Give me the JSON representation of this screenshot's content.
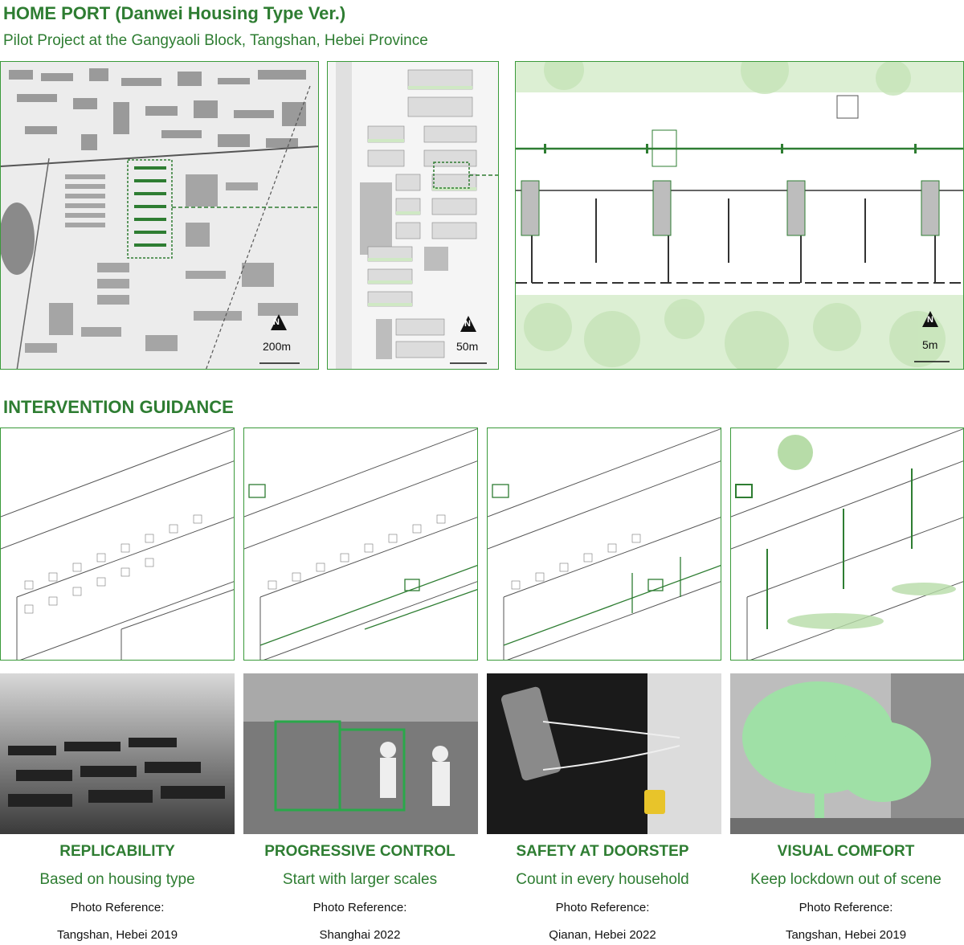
{
  "header": {
    "title": "HOME PORT (Danwei Housing Type Ver.)",
    "subtitle": "Pilot Project at the Gangyaoli Block, Tangshan, Hebei Province"
  },
  "maps": [
    {
      "north": "N",
      "scale": "200m"
    },
    {
      "north": "N",
      "scale": "50m"
    },
    {
      "north": "N",
      "scale": "5m"
    }
  ],
  "section_title": "INTERVENTION GUIDANCE",
  "guidance": [
    {
      "heading": "REPLICABILITY",
      "sub": "Based on housing type",
      "ref_label": "Photo Reference:",
      "ref_place": "Tangshan, Hebei 2019"
    },
    {
      "heading": "PROGRESSIVE CONTROL",
      "sub": "Start with larger scales",
      "ref_label": "Photo Reference:",
      "ref_place": "Shanghai 2022"
    },
    {
      "heading": "SAFETY AT DOORSTEP",
      "sub": "Count in every household",
      "ref_label": "Photo Reference:",
      "ref_place": "Qianan, Hebei 2022"
    },
    {
      "heading": "VISUAL COMFORT",
      "sub": "Keep lockdown out of scene",
      "ref_label": "Photo Reference:",
      "ref_place": "Tangshan, Hebei 2019"
    }
  ],
  "colors": {
    "accent": "#2e7d32",
    "light_green": "#cfe8c4",
    "frame": "#3a9a3a"
  }
}
